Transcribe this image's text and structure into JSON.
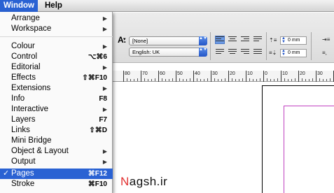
{
  "menubar": {
    "window": "Window",
    "help": "Help"
  },
  "window_menu": {
    "items": [
      {
        "label": "Arrange",
        "shortcut": "",
        "submenu": true,
        "checked": false
      },
      {
        "label": "Workspace",
        "shortcut": "",
        "submenu": true,
        "checked": false
      },
      {
        "label": "Colour",
        "shortcut": "",
        "submenu": true,
        "checked": false
      },
      {
        "label": "Control",
        "shortcut": "⌥⌘6",
        "submenu": false,
        "checked": false
      },
      {
        "label": "Editorial",
        "shortcut": "",
        "submenu": true,
        "checked": false
      },
      {
        "label": "Effects",
        "shortcut": "⇧⌘F10",
        "submenu": false,
        "checked": false
      },
      {
        "label": "Extensions",
        "shortcut": "",
        "submenu": true,
        "checked": false
      },
      {
        "label": "Info",
        "shortcut": "F8",
        "submenu": false,
        "checked": false
      },
      {
        "label": "Interactive",
        "shortcut": "",
        "submenu": true,
        "checked": false
      },
      {
        "label": "Layers",
        "shortcut": "F7",
        "submenu": false,
        "checked": false
      },
      {
        "label": "Links",
        "shortcut": "⇧⌘D",
        "submenu": false,
        "checked": false
      },
      {
        "label": "Mini Bridge",
        "shortcut": "",
        "submenu": false,
        "checked": false
      },
      {
        "label": "Object & Layout",
        "shortcut": "",
        "submenu": true,
        "checked": false
      },
      {
        "label": "Output",
        "shortcut": "",
        "submenu": true,
        "checked": false
      },
      {
        "label": "Pages",
        "shortcut": "⌘F12",
        "submenu": false,
        "checked": true
      },
      {
        "label": "Stroke",
        "shortcut": "⌘F10",
        "submenu": false,
        "checked": false
      }
    ],
    "check_mark": "✓",
    "arrow": "▶"
  },
  "control_panel": {
    "char_style_icon": "A.",
    "char_style_arrow": "▾",
    "style_select": "[None]",
    "language_select": "English: UK",
    "space_before": "0 mm",
    "space_after": "0 mm",
    "stepper_glyph": "▲▼"
  },
  "ruler": {
    "labels": [
      "80",
      "70",
      "60",
      "50",
      "40",
      "30",
      "20",
      "10",
      "0",
      "10",
      "20",
      "30",
      "4"
    ]
  },
  "watermark": {
    "first": "N",
    "rest": "agsh.ir"
  },
  "colors": {
    "selection": "#2a62d3",
    "margin_guide": "#c03fc0",
    "watermark_accent": "#e23030"
  }
}
